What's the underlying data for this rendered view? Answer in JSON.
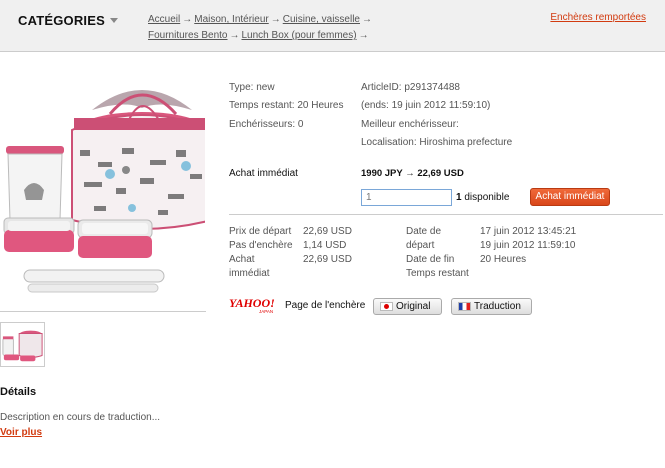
{
  "header": {
    "categories_label": "CATÉGORIES",
    "breadcrumb": [
      "Accueil",
      "Maison, Intérieur",
      "Cuisine, vaisselle",
      "Fournitures Bento",
      "Lunch Box (pour femmes)"
    ],
    "arrow": "→",
    "ended_link": "Enchères remportées"
  },
  "item": {
    "type": "Type: new",
    "time_left": "Temps restant: 20 Heures",
    "bidders": "Enchérisseurs: 0",
    "article_id": "ArticleID: p291374488",
    "ends": "(ends: 19 juin 2012 11:59:10)",
    "best_bidder": "Meilleur enchérisseur:",
    "location": "Localisation: Hiroshima prefecture"
  },
  "buy": {
    "label": "Achat immédiat",
    "price": "1990 JPY → 22,69 USD",
    "qty_value": "1",
    "available_count": "1",
    "available_text": "disponible",
    "button": "Achat immédiat"
  },
  "prices": {
    "start_label": "Prix de départ",
    "start_value": "22,69 USD",
    "increment_label": "Pas d'enchère",
    "increment_value": "1,14 USD",
    "buynow_label_1": "Achat",
    "buynow_label_2": "immédiat",
    "buynow_value": "22,69 USD"
  },
  "dates": {
    "start_label_1": "Date de",
    "start_label_2": "départ",
    "start_value": "17 juin 2012 13:45:21",
    "end_label": "Date de fin",
    "end_value": "19 juin 2012 11:59:10",
    "remaining_label": "Temps restant",
    "remaining_value": "20 Heures"
  },
  "auction": {
    "logo_text": "YAHOO!",
    "logo_sub": "JAPAN",
    "page_label": "Page de l'enchère",
    "original_button": "Original",
    "translate_button": "Traduction"
  },
  "details": {
    "heading": "Détails",
    "description": "Description en cours de traduction...",
    "more": "Voir plus"
  },
  "colors": {
    "accent": "#d23b10",
    "buy_button": "#e2532a",
    "product_pink": "#e0577f"
  }
}
